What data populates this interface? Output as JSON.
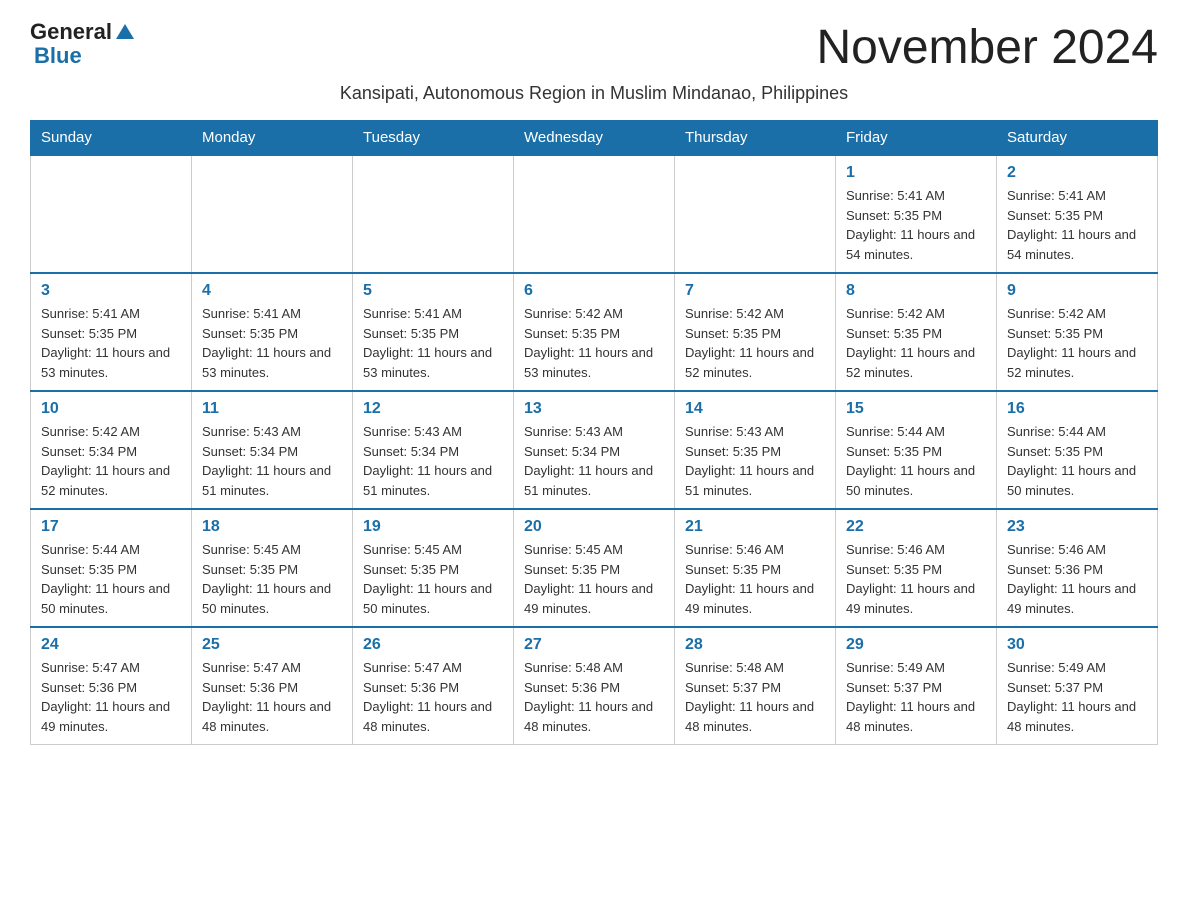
{
  "logo": {
    "text_general": "General",
    "text_blue": "Blue"
  },
  "page_title": "November 2024",
  "subtitle": "Kansipati, Autonomous Region in Muslim Mindanao, Philippines",
  "days_of_week": [
    "Sunday",
    "Monday",
    "Tuesday",
    "Wednesday",
    "Thursday",
    "Friday",
    "Saturday"
  ],
  "weeks": [
    [
      {
        "day": "",
        "info": ""
      },
      {
        "day": "",
        "info": ""
      },
      {
        "day": "",
        "info": ""
      },
      {
        "day": "",
        "info": ""
      },
      {
        "day": "",
        "info": ""
      },
      {
        "day": "1",
        "info": "Sunrise: 5:41 AM\nSunset: 5:35 PM\nDaylight: 11 hours and 54 minutes."
      },
      {
        "day": "2",
        "info": "Sunrise: 5:41 AM\nSunset: 5:35 PM\nDaylight: 11 hours and 54 minutes."
      }
    ],
    [
      {
        "day": "3",
        "info": "Sunrise: 5:41 AM\nSunset: 5:35 PM\nDaylight: 11 hours and 53 minutes."
      },
      {
        "day": "4",
        "info": "Sunrise: 5:41 AM\nSunset: 5:35 PM\nDaylight: 11 hours and 53 minutes."
      },
      {
        "day": "5",
        "info": "Sunrise: 5:41 AM\nSunset: 5:35 PM\nDaylight: 11 hours and 53 minutes."
      },
      {
        "day": "6",
        "info": "Sunrise: 5:42 AM\nSunset: 5:35 PM\nDaylight: 11 hours and 53 minutes."
      },
      {
        "day": "7",
        "info": "Sunrise: 5:42 AM\nSunset: 5:35 PM\nDaylight: 11 hours and 52 minutes."
      },
      {
        "day": "8",
        "info": "Sunrise: 5:42 AM\nSunset: 5:35 PM\nDaylight: 11 hours and 52 minutes."
      },
      {
        "day": "9",
        "info": "Sunrise: 5:42 AM\nSunset: 5:35 PM\nDaylight: 11 hours and 52 minutes."
      }
    ],
    [
      {
        "day": "10",
        "info": "Sunrise: 5:42 AM\nSunset: 5:34 PM\nDaylight: 11 hours and 52 minutes."
      },
      {
        "day": "11",
        "info": "Sunrise: 5:43 AM\nSunset: 5:34 PM\nDaylight: 11 hours and 51 minutes."
      },
      {
        "day": "12",
        "info": "Sunrise: 5:43 AM\nSunset: 5:34 PM\nDaylight: 11 hours and 51 minutes."
      },
      {
        "day": "13",
        "info": "Sunrise: 5:43 AM\nSunset: 5:34 PM\nDaylight: 11 hours and 51 minutes."
      },
      {
        "day": "14",
        "info": "Sunrise: 5:43 AM\nSunset: 5:35 PM\nDaylight: 11 hours and 51 minutes."
      },
      {
        "day": "15",
        "info": "Sunrise: 5:44 AM\nSunset: 5:35 PM\nDaylight: 11 hours and 50 minutes."
      },
      {
        "day": "16",
        "info": "Sunrise: 5:44 AM\nSunset: 5:35 PM\nDaylight: 11 hours and 50 minutes."
      }
    ],
    [
      {
        "day": "17",
        "info": "Sunrise: 5:44 AM\nSunset: 5:35 PM\nDaylight: 11 hours and 50 minutes."
      },
      {
        "day": "18",
        "info": "Sunrise: 5:45 AM\nSunset: 5:35 PM\nDaylight: 11 hours and 50 minutes."
      },
      {
        "day": "19",
        "info": "Sunrise: 5:45 AM\nSunset: 5:35 PM\nDaylight: 11 hours and 50 minutes."
      },
      {
        "day": "20",
        "info": "Sunrise: 5:45 AM\nSunset: 5:35 PM\nDaylight: 11 hours and 49 minutes."
      },
      {
        "day": "21",
        "info": "Sunrise: 5:46 AM\nSunset: 5:35 PM\nDaylight: 11 hours and 49 minutes."
      },
      {
        "day": "22",
        "info": "Sunrise: 5:46 AM\nSunset: 5:35 PM\nDaylight: 11 hours and 49 minutes."
      },
      {
        "day": "23",
        "info": "Sunrise: 5:46 AM\nSunset: 5:36 PM\nDaylight: 11 hours and 49 minutes."
      }
    ],
    [
      {
        "day": "24",
        "info": "Sunrise: 5:47 AM\nSunset: 5:36 PM\nDaylight: 11 hours and 49 minutes."
      },
      {
        "day": "25",
        "info": "Sunrise: 5:47 AM\nSunset: 5:36 PM\nDaylight: 11 hours and 48 minutes."
      },
      {
        "day": "26",
        "info": "Sunrise: 5:47 AM\nSunset: 5:36 PM\nDaylight: 11 hours and 48 minutes."
      },
      {
        "day": "27",
        "info": "Sunrise: 5:48 AM\nSunset: 5:36 PM\nDaylight: 11 hours and 48 minutes."
      },
      {
        "day": "28",
        "info": "Sunrise: 5:48 AM\nSunset: 5:37 PM\nDaylight: 11 hours and 48 minutes."
      },
      {
        "day": "29",
        "info": "Sunrise: 5:49 AM\nSunset: 5:37 PM\nDaylight: 11 hours and 48 minutes."
      },
      {
        "day": "30",
        "info": "Sunrise: 5:49 AM\nSunset: 5:37 PM\nDaylight: 11 hours and 48 minutes."
      }
    ]
  ]
}
